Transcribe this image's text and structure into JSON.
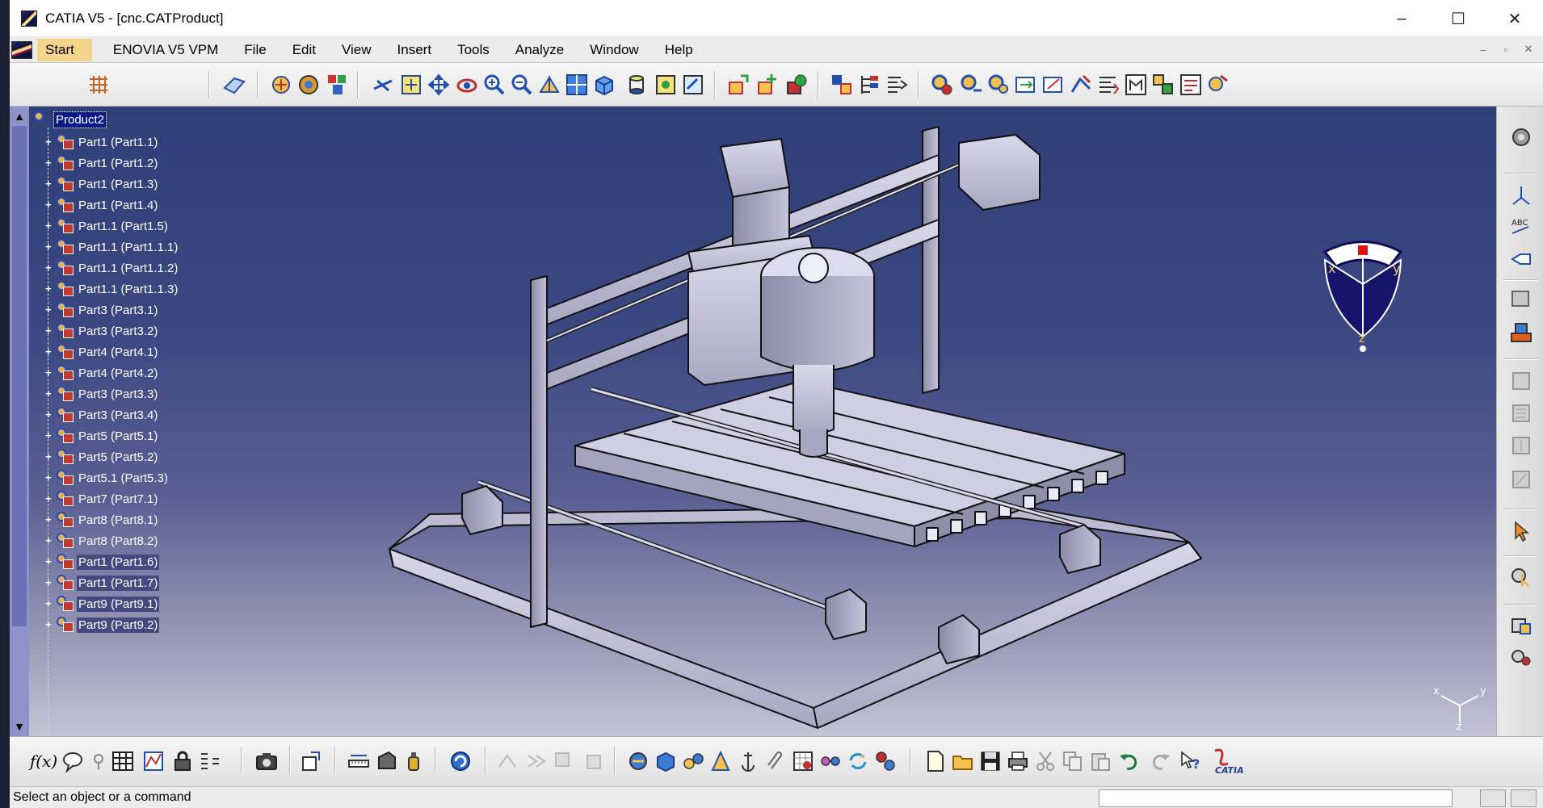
{
  "window": {
    "title": "CATIA V5 - [cnc.CATProduct]",
    "controls": [
      "–",
      "☐",
      "✕"
    ]
  },
  "menubar": {
    "items": [
      "Start",
      "ENOVIA V5 VPM",
      "File",
      "Edit",
      "View",
      "Insert",
      "Tools",
      "Analyze",
      "Window",
      "Help"
    ],
    "mdi_controls": [
      "–",
      "▫",
      "✕"
    ]
  },
  "tree": {
    "root": "Product2",
    "items": [
      "Part1 (Part1.1)",
      "Part1 (Part1.2)",
      "Part1 (Part1.3)",
      "Part1 (Part1.4)",
      "Part1.1 (Part1.5)",
      "Part1.1 (Part1.1.1)",
      "Part1.1 (Part1.1.2)",
      "Part1.1 (Part1.1.3)",
      "Part3 (Part3.1)",
      "Part3 (Part3.2)",
      "Part4 (Part4.1)",
      "Part4 (Part4.2)",
      "Part3 (Part3.3)",
      "Part3 (Part3.4)",
      "Part5 (Part5.1)",
      "Part5 (Part5.2)",
      "Part5.1 (Part5.3)",
      "Part7 (Part7.1)",
      "Part8 (Part8.1)",
      "Part8 (Part8.2)",
      "Part1 (Part1.6)",
      "Part1 (Part1.7)",
      "Part9 (Part9.1)",
      "Part9 (Part9.2)"
    ]
  },
  "compass": {
    "x_label": "x",
    "y_label": "y",
    "z_label": "z"
  },
  "axis_triad": {
    "x_label": "x",
    "y_label": "y",
    "z_label": "z"
  },
  "toolbar_bottom": {
    "fx_label": "f(x)"
  },
  "brand": {
    "label": "CATIA"
  },
  "status": {
    "message": "Select an object or a command"
  },
  "colors": {
    "viewport_top": "#2f3f78",
    "viewport_bottom": "#c5c4d6",
    "menu_start_bg": "#f3d58c",
    "tree_highlight": "#0a1a8a",
    "tree_selected": "#444a80"
  }
}
